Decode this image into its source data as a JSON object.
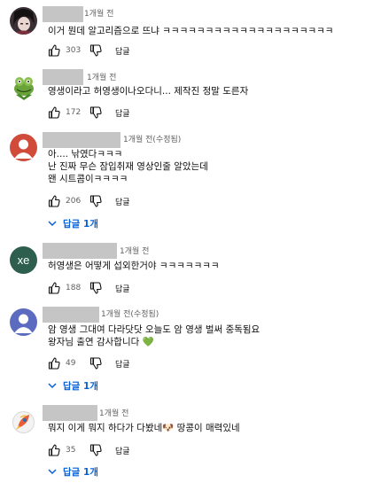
{
  "comments": [
    {
      "time": "1개월 전",
      "lines": [
        "이거 뭔데 알고리즘으로 뜨냐 ㅋㅋㅋㅋㅋㅋㅋㅋㅋㅋㅋㅋㅋㅋㅋㅋㅋㅋㅋㅋ"
      ],
      "likes": "303",
      "reply_label": "답글",
      "avatar": "dark-portrait-avatar"
    },
    {
      "time": "1개월 전",
      "lines": [
        "영생이라고 허영생이나오다니... 제작진 정말 도른자"
      ],
      "likes": "172",
      "reply_label": "답글",
      "avatar": "kermit-frog-avatar"
    },
    {
      "time": "1개월 전(수정됨)",
      "lines": [
        "아.... 낚였다ㅋㅋㅋ",
        "난 진짜 무슨 잠입취재 영상인줄 알았는데",
        "왠 시트콤이ㅋㅋㅋㅋ"
      ],
      "likes": "206",
      "reply_label": "답글",
      "replies_label": "답글 1개",
      "avatar": "default-user-avatar-red"
    },
    {
      "time": "1개월 전",
      "lines": [
        "허영생은 어떻게 섭외한거야 ㅋㅋㅋㅋㅋㅋㅋ"
      ],
      "likes": "188",
      "reply_label": "답글",
      "avatar_letters": "xe",
      "avatar": "letter-avatar"
    },
    {
      "time": "1개월 전(수정됨)",
      "lines": [
        "암 영생 그대여 다라닷닷 오늘도 암 영생 벌써 중독됨요",
        "왕자님 출연 감사합니다 💚"
      ],
      "likes": "49",
      "reply_label": "답글",
      "replies_label": "답글 1개",
      "avatar": "default-user-avatar-purple"
    },
    {
      "time": "1개월 전",
      "lines": [
        "뭐지 이게 뭐지 하다가 다봤네🐶 땅콩이 매력있네"
      ],
      "likes": "35",
      "reply_label": "답글",
      "replies_label": "답글 1개",
      "avatar": "rocket-avatar"
    }
  ],
  "colors": {
    "link": "#065fd4",
    "meta": "#606060",
    "name_placeholder": "#c5c5c5",
    "avatar_red": "#d14b3b",
    "avatar_purple": "#5c6bc0",
    "avatar_letter_bg": "#2e5e4e"
  },
  "icons": {
    "like": "thumbs-up-icon",
    "dislike": "thumbs-down-icon",
    "expand": "chevron-down-icon"
  }
}
